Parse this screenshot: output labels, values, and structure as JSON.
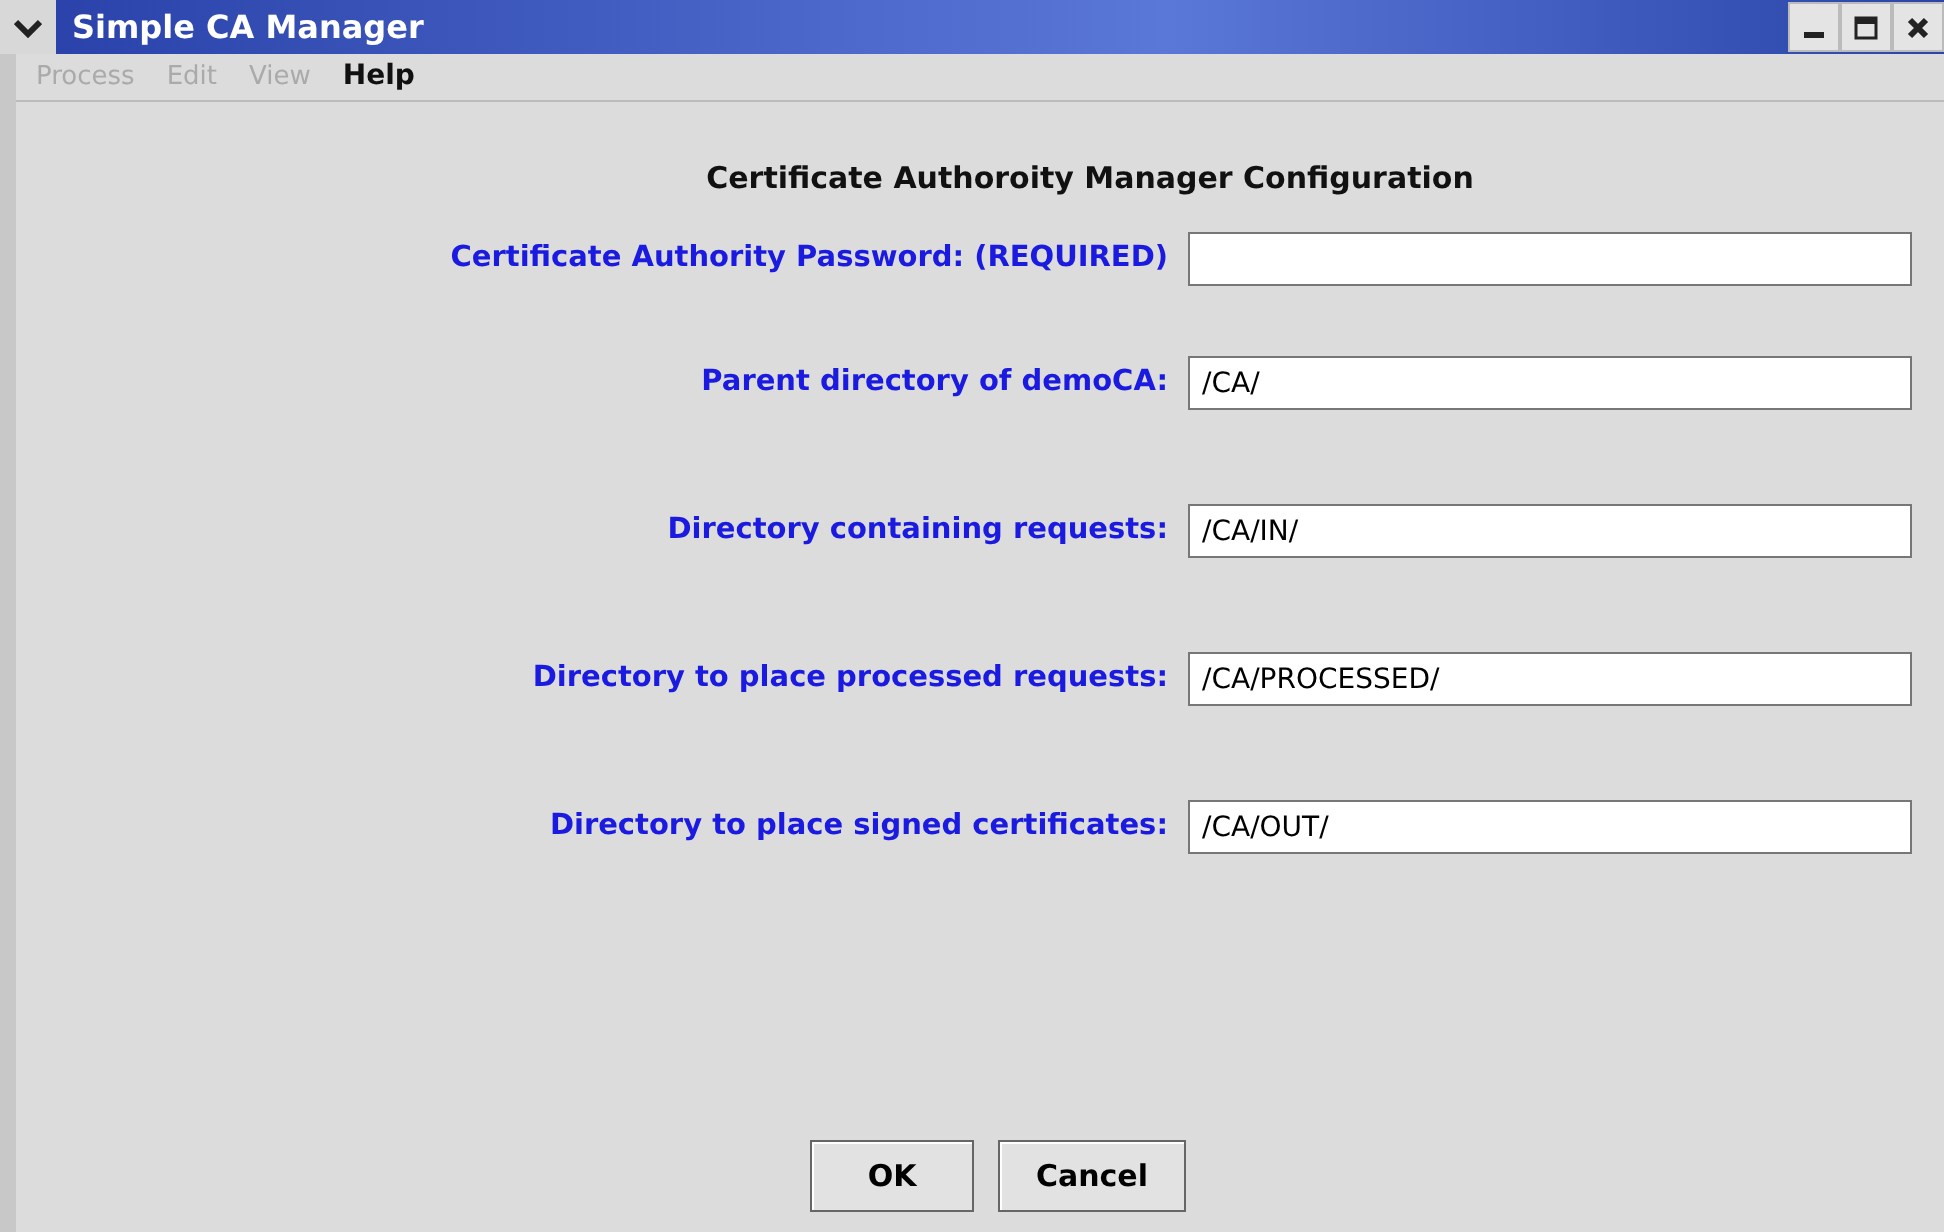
{
  "window": {
    "title": "Simple CA Manager"
  },
  "menu": [
    {
      "label": "Process",
      "disabled": true
    },
    {
      "label": "Edit",
      "disabled": true
    },
    {
      "label": "View",
      "disabled": true
    },
    {
      "label": "Help",
      "disabled": false
    }
  ],
  "heading": "Certificate Authoroity Manager Configuration",
  "fields": [
    {
      "label": "Certificate Authority Password: (REQUIRED)"
    },
    {
      "label": "Parent directory of demoCA:",
      "value": "/CA/"
    },
    {
      "label": "Directory containing requests:",
      "value": "/CA/IN/"
    },
    {
      "label": "Directory to place processed requests:",
      "value": "/CA/PROCESSED/"
    },
    {
      "label": "Directory to place signed certificates:",
      "value": "/CA/OUT/"
    }
  ],
  "buttons": [
    "OK",
    "Cancel"
  ]
}
